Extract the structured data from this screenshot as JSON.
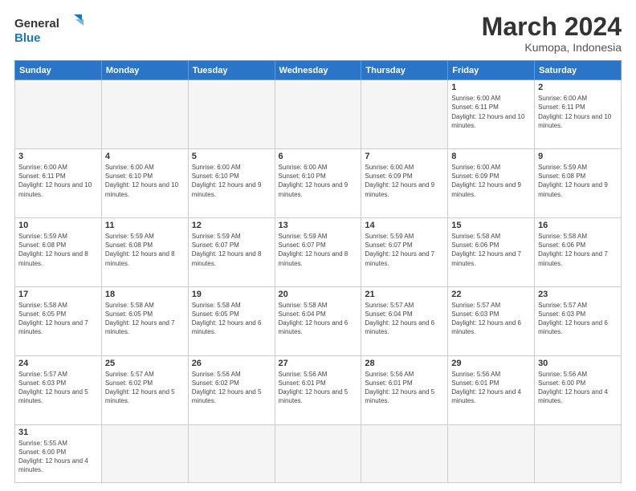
{
  "header": {
    "logo_general": "General",
    "logo_blue": "Blue",
    "month_title": "March 2024",
    "subtitle": "Kumopa, Indonesia"
  },
  "days_of_week": [
    "Sunday",
    "Monday",
    "Tuesday",
    "Wednesday",
    "Thursday",
    "Friday",
    "Saturday"
  ],
  "weeks": [
    [
      {
        "day": "",
        "info": ""
      },
      {
        "day": "",
        "info": ""
      },
      {
        "day": "",
        "info": ""
      },
      {
        "day": "",
        "info": ""
      },
      {
        "day": "",
        "info": ""
      },
      {
        "day": "1",
        "info": "Sunrise: 6:00 AM\nSunset: 6:11 PM\nDaylight: 12 hours and 10 minutes."
      },
      {
        "day": "2",
        "info": "Sunrise: 6:00 AM\nSunset: 6:11 PM\nDaylight: 12 hours and 10 minutes."
      }
    ],
    [
      {
        "day": "3",
        "info": "Sunrise: 6:00 AM\nSunset: 6:11 PM\nDaylight: 12 hours and 10 minutes."
      },
      {
        "day": "4",
        "info": "Sunrise: 6:00 AM\nSunset: 6:10 PM\nDaylight: 12 hours and 10 minutes."
      },
      {
        "day": "5",
        "info": "Sunrise: 6:00 AM\nSunset: 6:10 PM\nDaylight: 12 hours and 9 minutes."
      },
      {
        "day": "6",
        "info": "Sunrise: 6:00 AM\nSunset: 6:10 PM\nDaylight: 12 hours and 9 minutes."
      },
      {
        "day": "7",
        "info": "Sunrise: 6:00 AM\nSunset: 6:09 PM\nDaylight: 12 hours and 9 minutes."
      },
      {
        "day": "8",
        "info": "Sunrise: 6:00 AM\nSunset: 6:09 PM\nDaylight: 12 hours and 9 minutes."
      },
      {
        "day": "9",
        "info": "Sunrise: 5:59 AM\nSunset: 6:08 PM\nDaylight: 12 hours and 9 minutes."
      }
    ],
    [
      {
        "day": "10",
        "info": "Sunrise: 5:59 AM\nSunset: 6:08 PM\nDaylight: 12 hours and 8 minutes."
      },
      {
        "day": "11",
        "info": "Sunrise: 5:59 AM\nSunset: 6:08 PM\nDaylight: 12 hours and 8 minutes."
      },
      {
        "day": "12",
        "info": "Sunrise: 5:59 AM\nSunset: 6:07 PM\nDaylight: 12 hours and 8 minutes."
      },
      {
        "day": "13",
        "info": "Sunrise: 5:59 AM\nSunset: 6:07 PM\nDaylight: 12 hours and 8 minutes."
      },
      {
        "day": "14",
        "info": "Sunrise: 5:59 AM\nSunset: 6:07 PM\nDaylight: 12 hours and 7 minutes."
      },
      {
        "day": "15",
        "info": "Sunrise: 5:58 AM\nSunset: 6:06 PM\nDaylight: 12 hours and 7 minutes."
      },
      {
        "day": "16",
        "info": "Sunrise: 5:58 AM\nSunset: 6:06 PM\nDaylight: 12 hours and 7 minutes."
      }
    ],
    [
      {
        "day": "17",
        "info": "Sunrise: 5:58 AM\nSunset: 6:05 PM\nDaylight: 12 hours and 7 minutes."
      },
      {
        "day": "18",
        "info": "Sunrise: 5:58 AM\nSunset: 6:05 PM\nDaylight: 12 hours and 7 minutes."
      },
      {
        "day": "19",
        "info": "Sunrise: 5:58 AM\nSunset: 6:05 PM\nDaylight: 12 hours and 6 minutes."
      },
      {
        "day": "20",
        "info": "Sunrise: 5:58 AM\nSunset: 6:04 PM\nDaylight: 12 hours and 6 minutes."
      },
      {
        "day": "21",
        "info": "Sunrise: 5:57 AM\nSunset: 6:04 PM\nDaylight: 12 hours and 6 minutes."
      },
      {
        "day": "22",
        "info": "Sunrise: 5:57 AM\nSunset: 6:03 PM\nDaylight: 12 hours and 6 minutes."
      },
      {
        "day": "23",
        "info": "Sunrise: 5:57 AM\nSunset: 6:03 PM\nDaylight: 12 hours and 6 minutes."
      }
    ],
    [
      {
        "day": "24",
        "info": "Sunrise: 5:57 AM\nSunset: 6:03 PM\nDaylight: 12 hours and 5 minutes."
      },
      {
        "day": "25",
        "info": "Sunrise: 5:57 AM\nSunset: 6:02 PM\nDaylight: 12 hours and 5 minutes."
      },
      {
        "day": "26",
        "info": "Sunrise: 5:56 AM\nSunset: 6:02 PM\nDaylight: 12 hours and 5 minutes."
      },
      {
        "day": "27",
        "info": "Sunrise: 5:56 AM\nSunset: 6:01 PM\nDaylight: 12 hours and 5 minutes."
      },
      {
        "day": "28",
        "info": "Sunrise: 5:56 AM\nSunset: 6:01 PM\nDaylight: 12 hours and 5 minutes."
      },
      {
        "day": "29",
        "info": "Sunrise: 5:56 AM\nSunset: 6:01 PM\nDaylight: 12 hours and 4 minutes."
      },
      {
        "day": "30",
        "info": "Sunrise: 5:56 AM\nSunset: 6:00 PM\nDaylight: 12 hours and 4 minutes."
      }
    ],
    [
      {
        "day": "31",
        "info": "Sunrise: 5:55 AM\nSunset: 6:00 PM\nDaylight: 12 hours and 4 minutes."
      },
      {
        "day": "",
        "info": ""
      },
      {
        "day": "",
        "info": ""
      },
      {
        "day": "",
        "info": ""
      },
      {
        "day": "",
        "info": ""
      },
      {
        "day": "",
        "info": ""
      },
      {
        "day": "",
        "info": ""
      }
    ]
  ]
}
